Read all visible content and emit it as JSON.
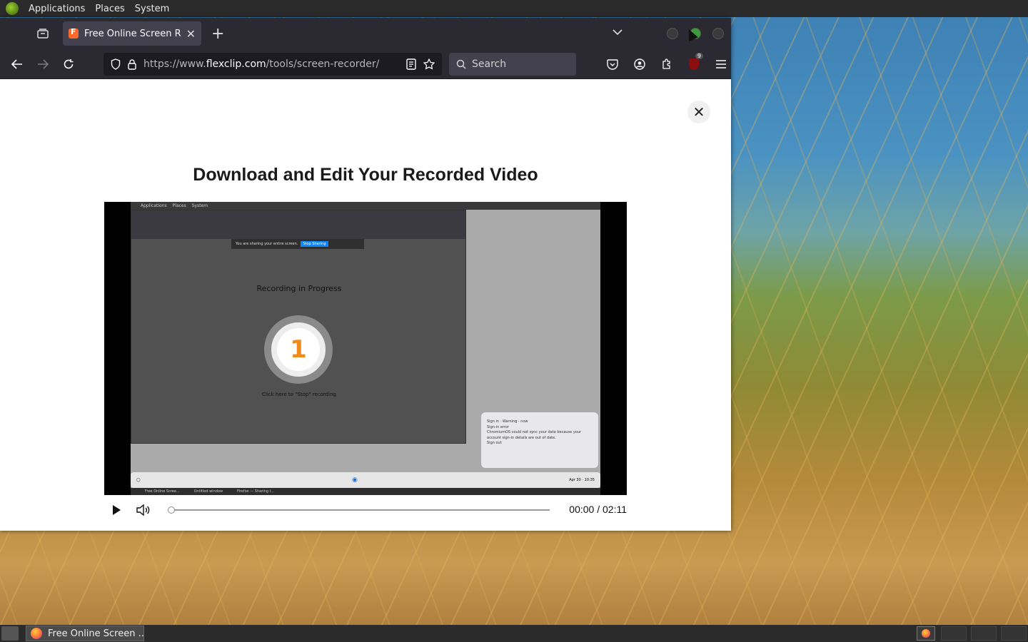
{
  "top_panel": {
    "menus": [
      "Applications",
      "Places",
      "System"
    ]
  },
  "browser": {
    "tab": {
      "title": "Free Online Screen Recorde"
    },
    "url": {
      "prefix": "https://www.",
      "domain": "flexclip.com",
      "path": "/tools/screen-recorder/"
    },
    "search_placeholder": "Search",
    "ublock_badge": "9"
  },
  "modal": {
    "title": "Download and Edit Your Recorded Video",
    "close_label": "✕"
  },
  "video": {
    "nested": {
      "top_menus": [
        "Applications",
        "Places",
        "System"
      ],
      "sharing_text": "You are sharing your entire screen.",
      "stop_sharing": "Stop Sharing",
      "recording_title": "Recording in Progress",
      "counter": "1",
      "click_hint": "Click here to \"Stop\" recording",
      "notify_title": "Sign in · Warning · now",
      "notify_head": "Sign-in error",
      "notify_body": "ChromiumOS could not sync your data because your account sign-in details are out of date.",
      "notify_action": "Sign out",
      "shelf_date": "Apr 30",
      "shelf_time": "10:35",
      "taskbar_items": [
        "Free Online Scree...",
        "Untitled window",
        "Firefox — Sharing I..."
      ]
    },
    "current_time": "00:00",
    "duration": "02:11",
    "progress": 0
  },
  "taskbar": {
    "item_label": "Free Online Screen ..."
  },
  "colors": {
    "accent": "#f08a1e",
    "chrome_bg": "#2b2a33"
  }
}
